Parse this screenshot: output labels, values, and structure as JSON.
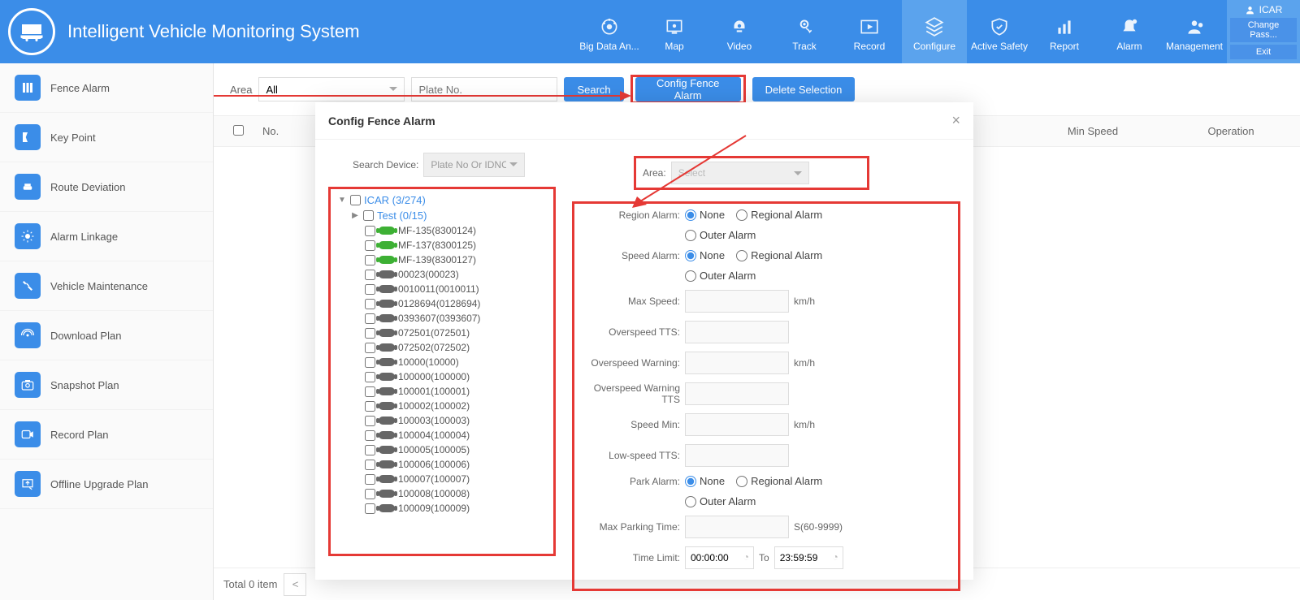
{
  "app": {
    "title": "Intelligent Vehicle Monitoring System"
  },
  "user": {
    "name": "ICAR",
    "change_pass": "Change Pass...",
    "exit": "Exit"
  },
  "nav": [
    {
      "id": "bigdata",
      "label": "Big Data An..."
    },
    {
      "id": "map",
      "label": "Map"
    },
    {
      "id": "video",
      "label": "Video"
    },
    {
      "id": "track",
      "label": "Track"
    },
    {
      "id": "record",
      "label": "Record"
    },
    {
      "id": "configure",
      "label": "Configure",
      "active": true
    },
    {
      "id": "active-safety",
      "label": "Active Safety"
    },
    {
      "id": "report",
      "label": "Report"
    },
    {
      "id": "alarm",
      "label": "Alarm"
    },
    {
      "id": "management",
      "label": "Management"
    }
  ],
  "sidebar": [
    {
      "id": "fence-alarm",
      "label": "Fence Alarm"
    },
    {
      "id": "key-point",
      "label": "Key Point"
    },
    {
      "id": "route-deviation",
      "label": "Route Deviation"
    },
    {
      "id": "alarm-linkage",
      "label": "Alarm Linkage"
    },
    {
      "id": "vehicle-maintenance",
      "label": "Vehicle Maintenance"
    },
    {
      "id": "download-plan",
      "label": "Download Plan"
    },
    {
      "id": "snapshot-plan",
      "label": "Snapshot Plan"
    },
    {
      "id": "record-plan",
      "label": "Record Plan"
    },
    {
      "id": "offline-upgrade-plan",
      "label": "Offline Upgrade Plan"
    }
  ],
  "toolbar": {
    "area_label": "Area",
    "area_value": "All",
    "plate_placeholder": "Plate No.",
    "search": "Search",
    "config_fence": "Config Fence Alarm",
    "delete_sel": "Delete Selection"
  },
  "table": {
    "col_no": "No.",
    "col_min": "Min Speed",
    "col_op": "Operation"
  },
  "pager": {
    "total": "Total 0 item"
  },
  "dialog": {
    "title": "Config Fence Alarm",
    "search_device_label": "Search Device:",
    "search_device_placeholder": "Plate No Or IDNO",
    "tree": {
      "root": "ICAR (3/274)",
      "group": "Test (0/15)",
      "vehicles": [
        {
          "name": "MF-135(8300124)",
          "on": true
        },
        {
          "name": "MF-137(8300125)",
          "on": true
        },
        {
          "name": "MF-139(8300127)",
          "on": true
        },
        {
          "name": "00023(00023)",
          "on": false
        },
        {
          "name": "0010011(0010011)",
          "on": false
        },
        {
          "name": "0128694(0128694)",
          "on": false
        },
        {
          "name": "0393607(0393607)",
          "on": false
        },
        {
          "name": "072501(072501)",
          "on": false
        },
        {
          "name": "072502(072502)",
          "on": false
        },
        {
          "name": "10000(10000)",
          "on": false
        },
        {
          "name": "100000(100000)",
          "on": false
        },
        {
          "name": "100001(100001)",
          "on": false
        },
        {
          "name": "100002(100002)",
          "on": false
        },
        {
          "name": "100003(100003)",
          "on": false
        },
        {
          "name": "100004(100004)",
          "on": false
        },
        {
          "name": "100005(100005)",
          "on": false
        },
        {
          "name": "100006(100006)",
          "on": false
        },
        {
          "name": "100007(100007)",
          "on": false
        },
        {
          "name": "100008(100008)",
          "on": false
        },
        {
          "name": "100009(100009)",
          "on": false
        }
      ]
    },
    "form": {
      "area_label": "Area:",
      "area_placeholder": "Select",
      "labels": {
        "region_alarm": "Region Alarm:",
        "speed_alarm": "Speed Alarm:",
        "max_speed": "Max Speed:",
        "overspeed_tts": "Overspeed TTS:",
        "overspeed_warning": "Overspeed Warning:",
        "overspeed_warning_tts": "Overspeed Warning TTS",
        "speed_min": "Speed Min:",
        "low_speed_tts": "Low-speed TTS:",
        "park_alarm": "Park Alarm:",
        "max_parking": "Max Parking Time:",
        "time_limit": "Time Limit:"
      },
      "options": {
        "none": "None",
        "regional": "Regional Alarm",
        "outer": "Outer Alarm"
      },
      "units": {
        "kmh": "km/h",
        "parking": "S(60-9999)",
        "to": "To"
      },
      "time_from": "00:00:00",
      "time_to": "23:59:59"
    }
  }
}
